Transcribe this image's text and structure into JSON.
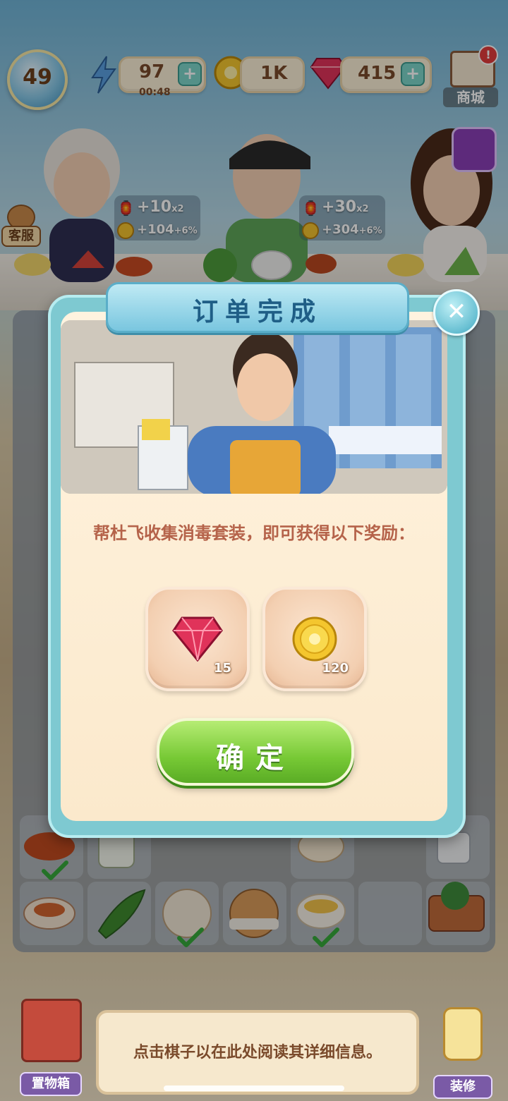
{
  "hud": {
    "level": "49",
    "energy": {
      "value": "97",
      "timer": "00:48",
      "icon": "lightning-icon"
    },
    "coins": {
      "value": "1K",
      "icon": "coin-icon"
    },
    "gems": {
      "value": "415",
      "icon": "gem-icon"
    },
    "shop": {
      "label": "商城"
    }
  },
  "customer_service": {
    "label": "客服"
  },
  "customers": [
    {
      "reward_lanterns": "+10",
      "lantern_mult": "x2",
      "reward_coins": "+104",
      "coin_bonus": "+6%"
    },
    {
      "reward_lanterns": "+30",
      "lantern_mult": "x2",
      "reward_coins": "+304",
      "coin_bonus": "+6%"
    }
  ],
  "modal": {
    "title": "订单完成",
    "description": "帮杜飞收集消毒套装，即可获得以下奖励：",
    "rewards": [
      {
        "icon": "gem-icon",
        "count": "15"
      },
      {
        "icon": "coin-icon",
        "count": "120"
      }
    ],
    "confirm_label": "确定"
  },
  "bottom": {
    "storage_label": "置物箱",
    "info_text": "点击棋子以在此处阅读其详细信息。",
    "decorate_label": "装修"
  },
  "colors": {
    "modal_frame": "#7ec9d1",
    "modal_title": "#1f5e86",
    "description": "#b5634a",
    "confirm_green": "#77c935"
  }
}
